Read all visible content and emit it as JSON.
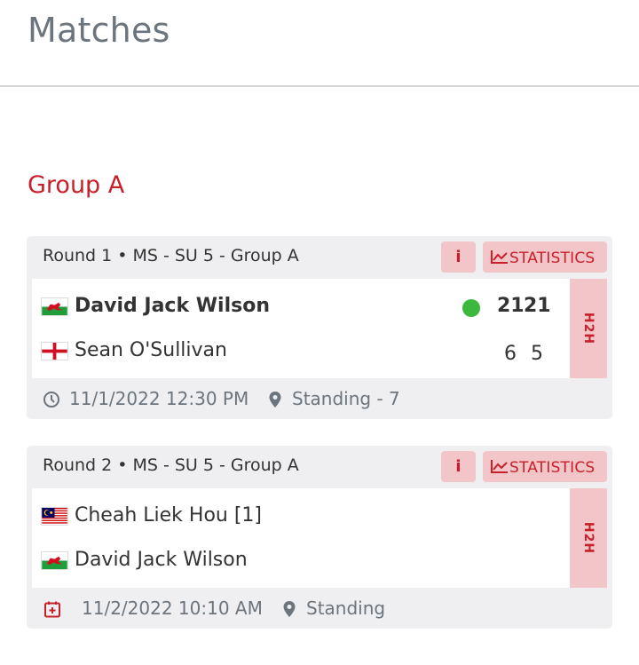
{
  "page": {
    "title": "Matches"
  },
  "group": {
    "title": "Group A"
  },
  "colors": {
    "accent": "#c8202a",
    "accent_soft": "#f2c5c8",
    "winner": "#3cb83c",
    "muted": "#6c757d"
  },
  "matches": [
    {
      "round": "Round 1",
      "separator": "•",
      "event": "MS - SU 5 - Group A",
      "info_label": "i",
      "stats_label": "STATISTICS",
      "h2h_label": "H2H",
      "players": [
        {
          "name": "David Jack Wilson",
          "flag": "wales-flag-icon",
          "winner": true,
          "scores": [
            "21",
            "21"
          ]
        },
        {
          "name": "Sean O'Sullivan",
          "flag": "england-flag-icon",
          "winner": false,
          "scores": [
            "6",
            "5"
          ]
        }
      ],
      "datetime": "11/1/2022 12:30 PM",
      "datetime_icon": "clock-icon",
      "court": "Standing - 7",
      "court_icon": "location-pin-icon"
    },
    {
      "round": "Round 2",
      "separator": "•",
      "event": "MS - SU 5 - Group A",
      "info_label": "i",
      "stats_label": "STATISTICS",
      "h2h_label": "H2H",
      "players": [
        {
          "name": "Cheah Liek Hou [1]",
          "flag": "malaysia-flag-icon",
          "winner": false,
          "scores": []
        },
        {
          "name": "David Jack Wilson",
          "flag": "wales-flag-icon",
          "winner": false,
          "scores": []
        }
      ],
      "datetime": "11/2/2022 10:10 AM",
      "datetime_icon": "calendar-add-icon",
      "court": "Standing",
      "court_icon": "location-pin-icon"
    }
  ]
}
